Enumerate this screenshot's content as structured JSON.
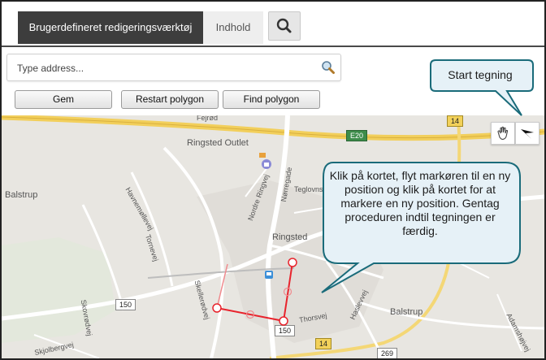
{
  "tabs": {
    "active_label": "Brugerdefineret redigeringsværktøj",
    "inactive_label": "Indhold"
  },
  "search": {
    "placeholder": "Type address..."
  },
  "buttons": {
    "gem": "Gem",
    "restart": "Restart polygon",
    "find": "Find polygon"
  },
  "map": {
    "places": {
      "ringsted_outlet": "Ringsted Outlet",
      "ringsted": "Ringsted",
      "balstrup_right": "Balstrup",
      "balstrup_left": "Balstrup",
      "fejroed": "Fejrød"
    },
    "streets": {
      "nordre_ringvej": "Nordre Ringvej",
      "norregade": "Nørregade",
      "teglovns": "Teglovns",
      "havnemollevej": "Havnemøllevej",
      "tornevej": "Tornevej",
      "skellerodvej": "Skellerødvej",
      "thorsvej": "Thorsvej",
      "haslevvej": "Haslevvej",
      "adamshojvej": "Adamshøjvej",
      "skjolberg": "Skjolbergvej",
      "skovrodvej": "Skovrødvej"
    },
    "shields": {
      "e20": "E20",
      "r14_top": "14",
      "r14_bottom": "14",
      "r150_left": "150",
      "r150_center": "150",
      "r269": "269"
    }
  },
  "callouts": {
    "start": "Start tegning",
    "instructions": "Klik på kortet, flyt markøren til en ny position og klik på kortet for at markere en ny position. Gentag proceduren indtil tegningen er færdig."
  },
  "colors": {
    "callout_fill": "#e6f1f7",
    "callout_border": "#1a6b7a",
    "polygon": "#e8232c",
    "tab_active_bg": "#3d3d3d"
  }
}
